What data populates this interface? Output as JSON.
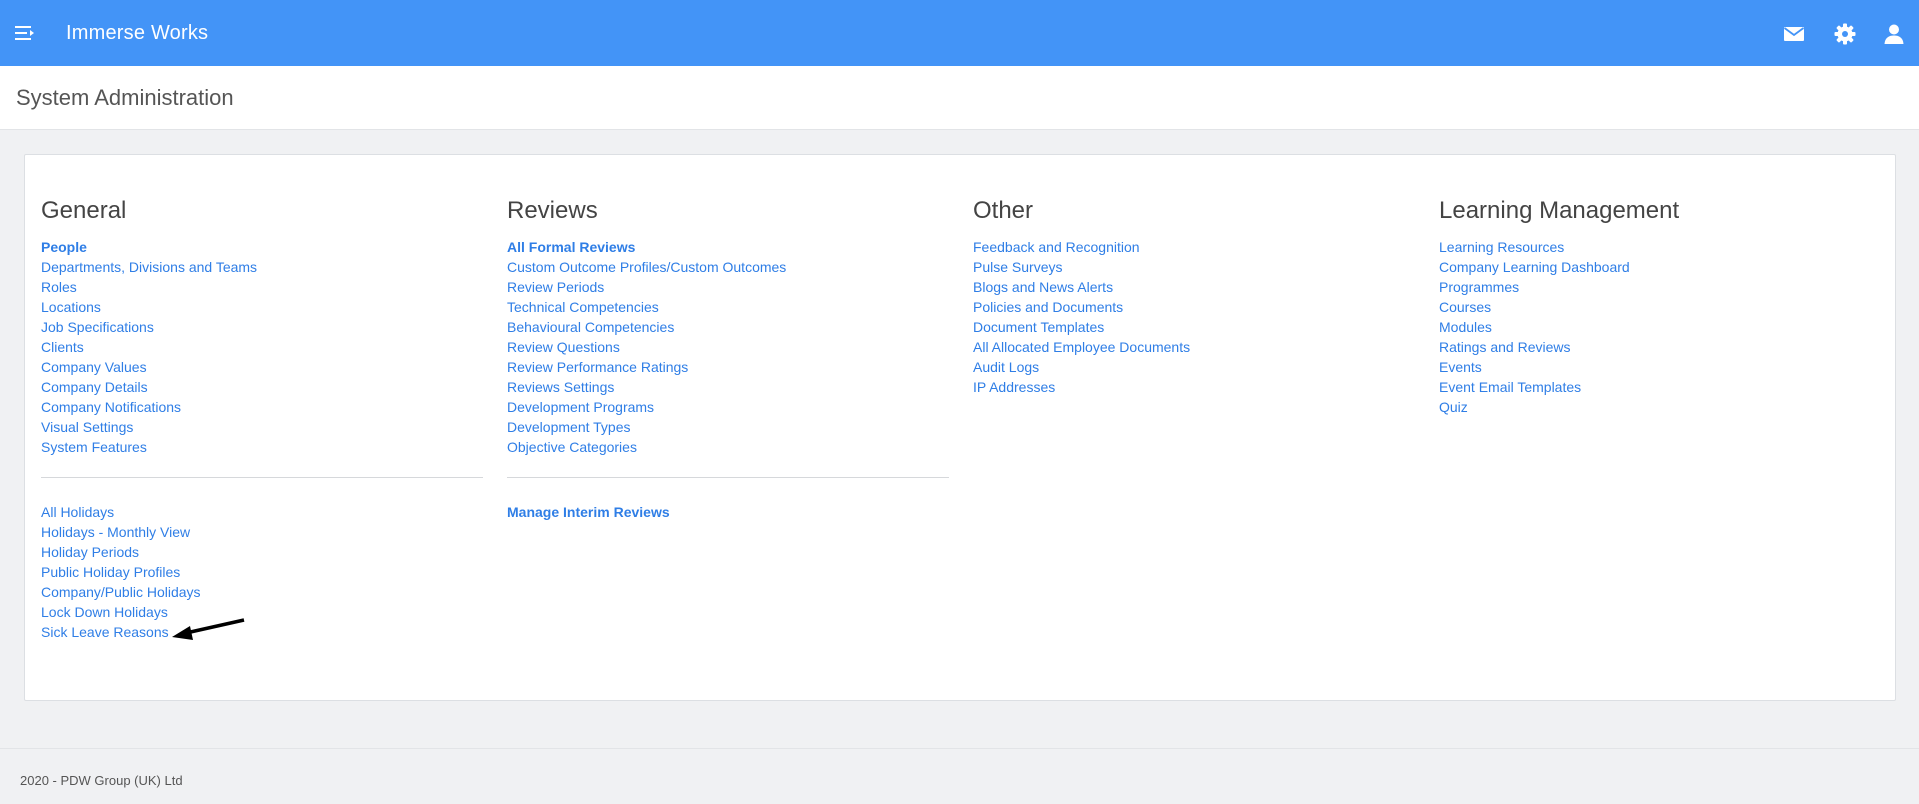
{
  "app": {
    "title": "Immerse Works"
  },
  "topbar": {
    "icons": [
      "menu-icon",
      "mail-icon",
      "gear-icon",
      "user-icon"
    ],
    "accent_color": "#4394f7"
  },
  "page": {
    "title": "System Administration"
  },
  "sections": {
    "general": {
      "heading": "General",
      "links": [
        "People",
        "Departments, Divisions and Teams",
        "Roles",
        "Locations",
        "Job Specifications",
        "Clients",
        "Company Values",
        "Company Details",
        "Company Notifications",
        "Visual Settings",
        "System Features"
      ],
      "links2": [
        "All Holidays",
        "Holidays - Monthly View",
        "Holiday Periods",
        "Public Holiday Profiles",
        "Company/Public Holidays",
        "Lock Down Holidays",
        "Sick Leave Reasons"
      ]
    },
    "reviews": {
      "heading": "Reviews",
      "links": [
        "All Formal Reviews",
        "Custom Outcome Profiles/Custom Outcomes",
        "Review Periods",
        "Technical Competencies",
        "Behavioural Competencies",
        "Review Questions",
        "Review Performance Ratings",
        "Reviews Settings",
        "Development Programs",
        "Development Types",
        "Objective Categories"
      ],
      "links2": [
        "Manage Interim Reviews"
      ]
    },
    "other": {
      "heading": "Other",
      "links": [
        "Feedback and Recognition",
        "Pulse Surveys",
        "Blogs and News Alerts",
        "Policies and Documents",
        "Document Templates",
        "All Allocated Employee Documents",
        "Audit Logs",
        "IP Addresses"
      ]
    },
    "learning": {
      "heading": "Learning Management",
      "links": [
        "Learning Resources",
        "Company Learning Dashboard",
        "Programmes",
        "Courses",
        "Modules",
        "Ratings and Reviews",
        "Events",
        "Event Email Templates",
        "Quiz"
      ]
    }
  },
  "footer": {
    "text": "2020 - PDW Group (UK) Ltd"
  },
  "link_color": "#2f7ee6"
}
